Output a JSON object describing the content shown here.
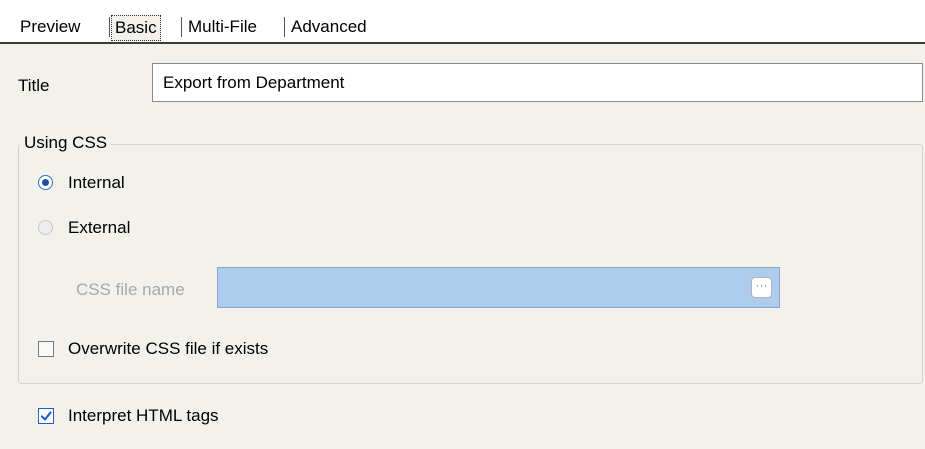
{
  "tabs": [
    {
      "label": "Preview"
    },
    {
      "label": "Basic",
      "selected": true
    },
    {
      "label": "Multi-File"
    },
    {
      "label": "Advanced"
    }
  ],
  "title_field": {
    "label": "Title",
    "value": "Export from Department"
  },
  "using_css": {
    "legend": "Using CSS",
    "options": [
      {
        "label": "Internal",
        "checked": true
      },
      {
        "label": "External",
        "checked": false
      }
    ],
    "css_file_name": {
      "label": "CSS file name",
      "value": "",
      "browse_label": "···"
    },
    "overwrite": {
      "label": "Overwrite CSS file if exists",
      "checked": false
    }
  },
  "interpret_html": {
    "label": "Interpret HTML tags",
    "checked": true
  },
  "colors": {
    "panel_background": "#f2f1eb",
    "disabled_input": "#aeccec",
    "check_accent": "#1f5fbf"
  }
}
